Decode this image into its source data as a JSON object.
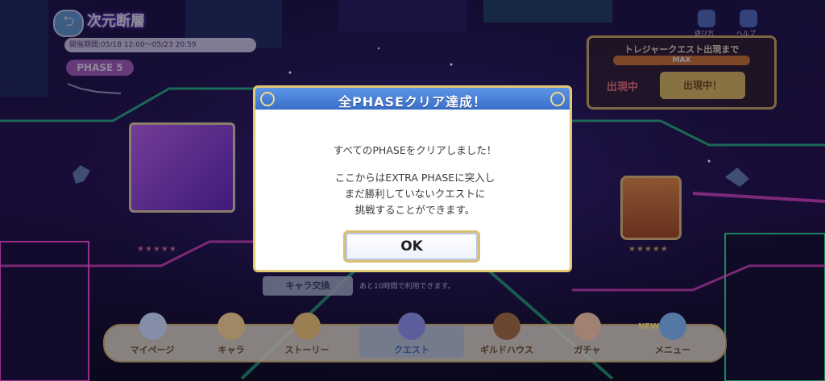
{
  "header": {
    "back_icon": "back-arrow-icon",
    "event_title": "次元断層",
    "event_period": "開催期間:05/18 12:00〜05/23 20:59",
    "phase_label": "PHASE 5"
  },
  "top_right": {
    "icons": [
      {
        "icon": "info-icon",
        "label": "遊び方"
      },
      {
        "icon": "help-icon",
        "label": "ヘルプ"
      }
    ],
    "treasure": {
      "title": "トレジャークエスト出現まで",
      "progress_text": "MAX",
      "count_text": "出現中",
      "button_label": "出現中！"
    }
  },
  "stage": {
    "chara_button": "キャラ交換",
    "chara_note": "あと10時間で利用できます。"
  },
  "nav": {
    "items": [
      {
        "label": "マイページ",
        "icon": "home-icon"
      },
      {
        "label": "キャラ",
        "icon": "character-icon"
      },
      {
        "label": "ストーリー",
        "icon": "story-icon"
      },
      {
        "label": "クエスト",
        "icon": "quest-swords-icon"
      },
      {
        "label": "ギルドハウス",
        "icon": "guildhouse-icon"
      },
      {
        "label": "ガチャ",
        "icon": "gacha-icon"
      },
      {
        "label": "メニュー",
        "icon": "menu-icon"
      }
    ],
    "active": "クエスト",
    "new_badge": "NEW"
  },
  "dialog": {
    "title": "全PHASEクリア達成！",
    "line1": "すべてのPHASEをクリアしました！",
    "line2": "ここからはEXTRA PHASEに突入し",
    "line3": "まだ勝利していないクエストに",
    "line4": "挑戦することができます。",
    "ok_label": "OK"
  },
  "colors": {
    "dialog_header": "#3a6fc9",
    "dialog_border": "#e2c774",
    "background": "#0c0a1e",
    "neon_green": "#2bd98a",
    "neon_pink": "#ff4fd8"
  }
}
